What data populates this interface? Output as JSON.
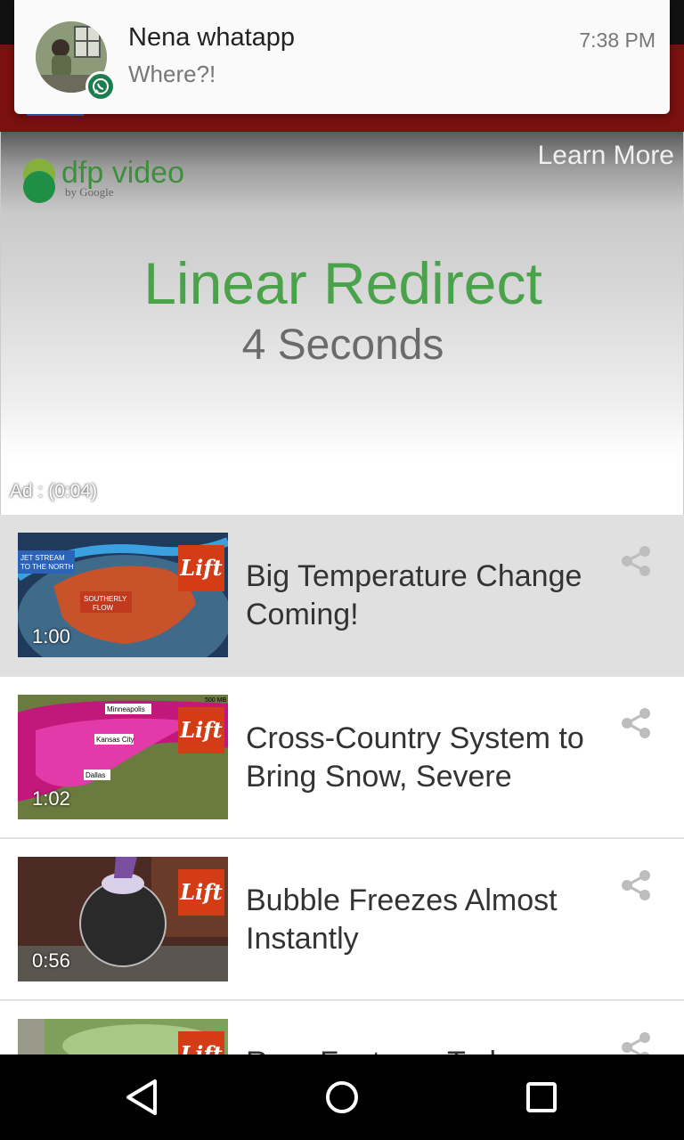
{
  "notification": {
    "title": "Nena whatapp",
    "message": "Where?!",
    "time": "7:38 PM",
    "app_icon": "whatsapp-icon"
  },
  "ad": {
    "brand_main": "dfp video",
    "brand_sub": "by Google",
    "learn_more": "Learn More",
    "headline": "Linear Redirect",
    "subline": "4 Seconds",
    "timer": "Ad : (0:04)"
  },
  "videos": [
    {
      "title": "Big Temperature Change Coming!",
      "duration": "1:00",
      "badge": "Lift",
      "selected": true
    },
    {
      "title": "Cross-Country System to Bring Snow, Severe",
      "duration": "1:02",
      "badge": "Lift",
      "selected": false
    },
    {
      "title": "Bubble Freezes Almost Instantly",
      "duration": "0:56",
      "badge": "Lift",
      "selected": false
    },
    {
      "title": "Rare Footage: Tod...",
      "duration": "",
      "badge": "Lift",
      "selected": false
    }
  ],
  "thumb_labels": {
    "v1": [
      "JET STREAM",
      "TO THE NORTH",
      "SOUTHERLY",
      "FLOW"
    ],
    "v2": [
      "Minneapolis",
      "Kansas City",
      "Dallas",
      "500 MB"
    ]
  },
  "navbar": {
    "back": "back-icon",
    "home": "home-icon",
    "recents": "recents-icon"
  },
  "colors": {
    "app_bar": "#7a1010",
    "ad_headline": "#4aa24a",
    "lift_badge": "#d43c16",
    "whatsapp": "#1e7d4f"
  }
}
